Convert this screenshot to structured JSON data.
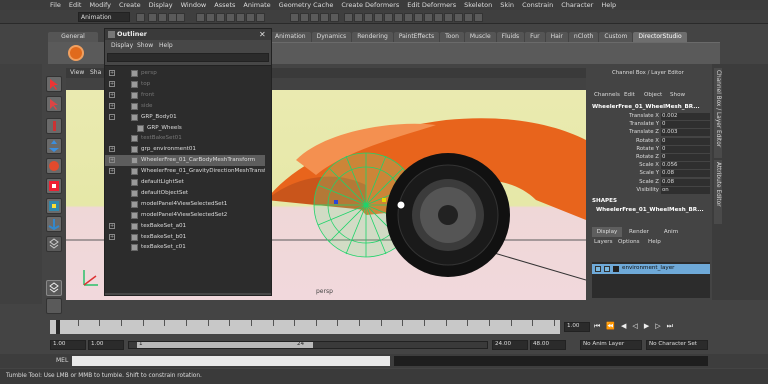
{
  "menu": [
    "File",
    "Edit",
    "Modify",
    "Create",
    "Display",
    "Window",
    "Assets",
    "Animate",
    "Geometry Cache",
    "Create Deformers",
    "Edit Deformers",
    "Skeleton",
    "Skin",
    "Constrain",
    "Character",
    "Help"
  ],
  "status": {
    "mode": "Animation"
  },
  "shelf": {
    "tab_left": "General",
    "tabs": [
      "Animation",
      "Dynamics",
      "Rendering",
      "PaintEffects",
      "Toon",
      "Muscle",
      "Fluids",
      "Fur",
      "Hair",
      "nCloth",
      "Custom",
      "DirectorStudio"
    ],
    "active_tab": "DirectorStudio"
  },
  "viewport": {
    "menu": [
      "View",
      "Sha"
    ],
    "camera_label": "persp"
  },
  "outliner": {
    "title": "Outliner",
    "menu": [
      "Display",
      "Show",
      "Help"
    ],
    "items": [
      {
        "label": "persp",
        "dim": true,
        "exp": "+"
      },
      {
        "label": "top",
        "dim": true,
        "exp": "+"
      },
      {
        "label": "front",
        "dim": true,
        "exp": "+"
      },
      {
        "label": "side",
        "dim": true,
        "exp": "+"
      },
      {
        "label": "GRP_Body01",
        "exp": "–"
      },
      {
        "label": "GRP_Wheels",
        "indent": true
      },
      {
        "label": "testBakeSet01",
        "dim": true
      },
      {
        "label": "grp_environment01",
        "exp": "+"
      },
      {
        "label": "WheelerFree_01_CarBodyMeshTransform",
        "exp": "+",
        "sel": true
      },
      {
        "label": "WheelerFree_01_GravityDirectionMeshTransf",
        "exp": "+"
      },
      {
        "label": "defaultLightSet"
      },
      {
        "label": "defaultObjectSet"
      },
      {
        "label": "modelPanel4ViewSelectedSet1"
      },
      {
        "label": "modelPanel4ViewSelectedSet2"
      },
      {
        "label": "texBakeSet_a01",
        "exp": "+"
      },
      {
        "label": "texBakeSet_b01",
        "exp": "+"
      },
      {
        "label": "texBakeSet_c01"
      }
    ]
  },
  "channelbox": {
    "title": "Channel Box / Layer Editor",
    "menu": [
      "Channels",
      "Edit",
      "Object",
      "Show"
    ],
    "object": "WheelerFree_01_WheelMesh_BR...",
    "attrs": [
      {
        "k": "Translate X",
        "v": "0.002"
      },
      {
        "k": "Translate Y",
        "v": "0"
      },
      {
        "k": "Translate Z",
        "v": "0.003"
      },
      {
        "k": "Rotate X",
        "v": "0"
      },
      {
        "k": "Rotate Y",
        "v": "0"
      },
      {
        "k": "Rotate Z",
        "v": "0"
      },
      {
        "k": "Scale X",
        "v": "0.056"
      },
      {
        "k": "Scale Y",
        "v": "0.08"
      },
      {
        "k": "Scale Z",
        "v": "0.08"
      },
      {
        "k": "Visibility",
        "v": "on"
      }
    ],
    "shapes_label": "SHAPES",
    "shape_name": "WheelerFree_01_WheelMesh_BR...",
    "layer_tabs": [
      "Display",
      "Render",
      "Anim"
    ],
    "layer_menu": [
      "Layers",
      "Options",
      "Help"
    ],
    "layer_name": "environment_layer",
    "side_tabs": [
      "Channel Box / Layer Editor",
      "Attribute Editor"
    ]
  },
  "timeline": {
    "ticks": [
      "1",
      "2",
      "3",
      "4",
      "5",
      "6",
      "7",
      "8",
      "9",
      "10",
      "11",
      "12",
      "13",
      "14",
      "15",
      "16",
      "17",
      "18",
      "19",
      "20",
      "21",
      "22",
      "23",
      "24"
    ],
    "current": "1.00",
    "range_start": "1.00",
    "range_start2": "1.00",
    "range_slider_start": "1",
    "range_slider_end": "24",
    "range_end": "24.00",
    "range_end2": "48.00",
    "anim_layer": "No Anim Layer",
    "character_set": "No Character Set"
  },
  "cmd": {
    "label": "MEL"
  },
  "help": "Tumble Tool: Use LMB or MMB to tumble. Shift to constrain rotation."
}
